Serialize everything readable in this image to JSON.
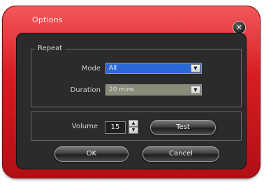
{
  "window": {
    "title": "Options"
  },
  "repeat_group": {
    "label": "Repeat",
    "mode_label": "Mode",
    "mode_value": "All",
    "duration_label": "Duration",
    "duration_value": "20 mins"
  },
  "volume": {
    "label": "Volume",
    "value": "15",
    "test_label": "Test"
  },
  "buttons": {
    "ok_label": "OK",
    "cancel_label": "Cancel"
  },
  "icons": {
    "close": "close-icon",
    "dropdown": "chevron-down-icon",
    "spin_up": "triangle-up-icon",
    "spin_down": "triangle-down-icon"
  },
  "colors": {
    "frame_red": "#d71d23",
    "panel_dark": "#2b2b2b",
    "selected_blue": "#2b68d8",
    "disabled_combo": "#8b8b7a"
  }
}
